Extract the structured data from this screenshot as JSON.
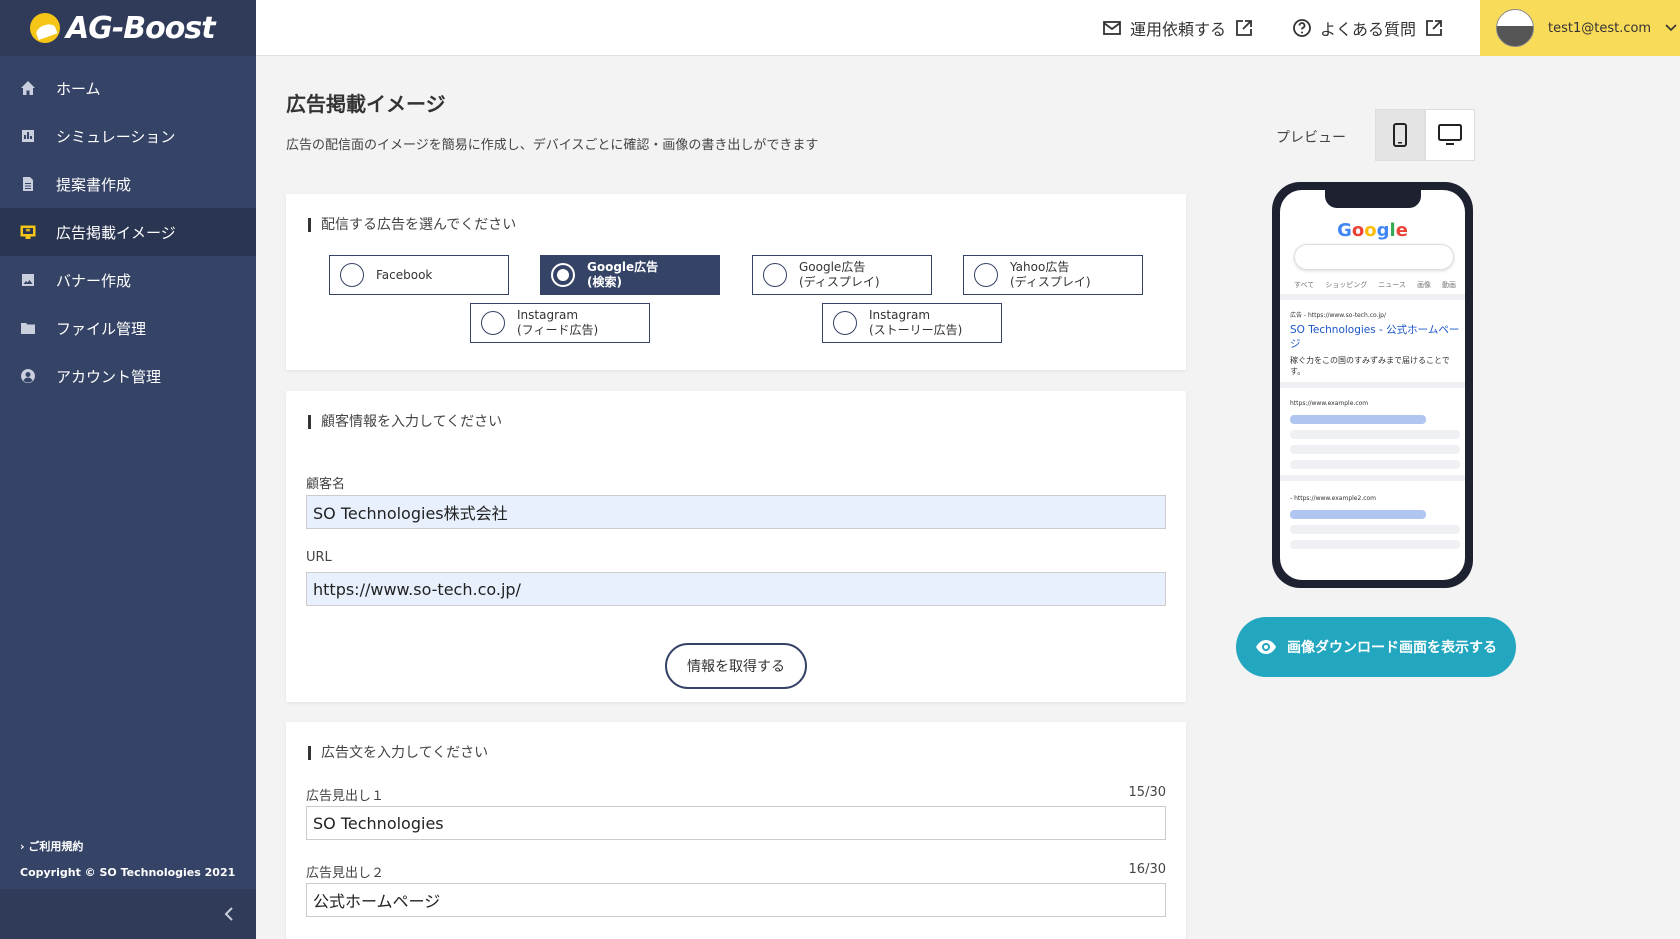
{
  "brand": {
    "name": "AG-Boost"
  },
  "sidebar": {
    "items": [
      {
        "label": "ホーム",
        "icon": "home-icon"
      },
      {
        "label": "シミュレーション",
        "icon": "chart-icon"
      },
      {
        "label": "提案書作成",
        "icon": "document-icon"
      },
      {
        "label": "広告掲載イメージ",
        "icon": "monitor-icon",
        "active": true
      },
      {
        "label": "バナー作成",
        "icon": "image-icon"
      },
      {
        "label": "ファイル管理",
        "icon": "folder-icon"
      },
      {
        "label": "アカウント管理",
        "icon": "user-circle-icon"
      }
    ],
    "terms": "ご利用規約",
    "copyright": "Copyright ©  SO Technologies 2021"
  },
  "header": {
    "request_link": "運用依頼する",
    "faq_link": "よくある質問",
    "user_email": "test1@test.com"
  },
  "main": {
    "title": "広告掲載イメージ",
    "description": "広告の配信面のイメージを簡易に作成し、デバイスごとに確認・画像の書き出しができます",
    "ad_select": {
      "title": "配信する広告を選んでください",
      "options": [
        {
          "line1": "Facebook",
          "line2": ""
        },
        {
          "line1": "Google広告",
          "line2": "(検索)",
          "selected": true
        },
        {
          "line1": "Google広告",
          "line2": "(ディスプレイ)"
        },
        {
          "line1": "Yahoo広告",
          "line2": "(ディスプレイ)"
        },
        {
          "line1": "Instagram",
          "line2": "(フィード広告)"
        },
        {
          "line1": "Instagram",
          "line2": "(ストーリー広告)"
        }
      ]
    },
    "customer": {
      "title": "顧客情報を入力してください",
      "name_label": "顧客名",
      "name_value": "SO Technologies株式会社",
      "url_label": "URL",
      "url_value": "https://www.so-tech.co.jp/",
      "fetch_button": "情報を取得する"
    },
    "ad_text": {
      "title": "広告文を入力してください",
      "headline1_label": "広告見出し１",
      "headline1_count": "15/30",
      "headline1_value": "SO Technologies",
      "headline2_label": "広告見出し２",
      "headline2_count": "16/30",
      "headline2_value": "公式ホームページ"
    }
  },
  "preview": {
    "label": "プレビュー",
    "google_logo": "Google",
    "tabs": [
      "すべて",
      "ショッピング",
      "ニュース",
      "画像",
      "動画"
    ],
    "ad_url": "広告 - https://www.so-tech.co.jp/",
    "ad_title": "SO Technologies - 公式ホームページ",
    "ad_desc": "稼ぐ力をこの国のすみずみまで届けることです。",
    "result1_url": "https://www.example.com",
    "result2_url": "- https://www.example2.com",
    "download_button": "画像ダウンロード画面を表示する"
  },
  "colors": {
    "sidebar": "#354366",
    "accent_yellow": "#f9db5a",
    "teal_button": "#23a6bf",
    "link_blue": "#1a55c8"
  }
}
